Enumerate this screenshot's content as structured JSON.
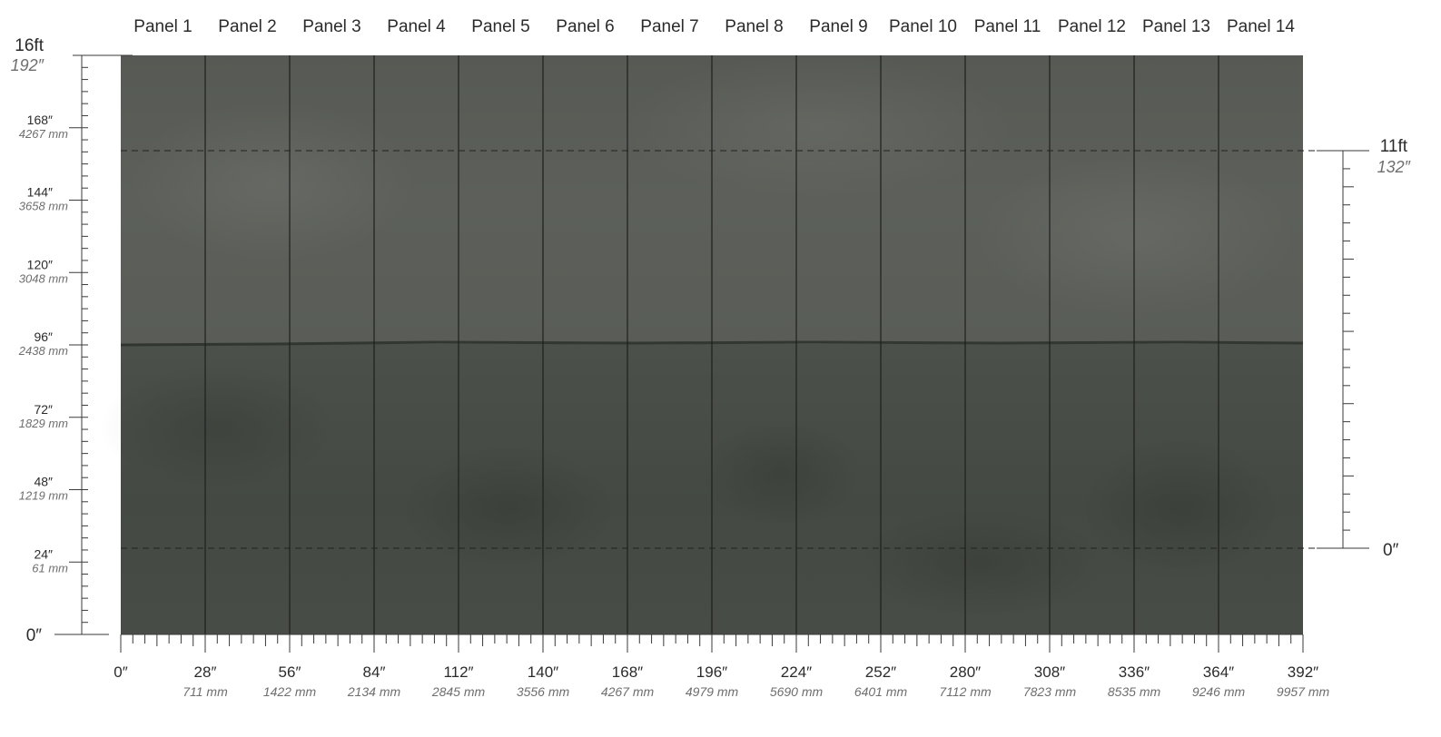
{
  "panels": [
    "Panel 1",
    "Panel 2",
    "Panel 3",
    "Panel 4",
    "Panel 5",
    "Panel 6",
    "Panel 7",
    "Panel 8",
    "Panel 9",
    "Panel 10",
    "Panel 11",
    "Panel 12",
    "Panel 13",
    "Panel 14"
  ],
  "colors": {
    "upper_wall": "#5a5c56",
    "lower_wall": "#474b45",
    "paint_line": "#2f322d",
    "panel_seam": "#1f1f1f",
    "dashed_line": "#222222",
    "ruler": "#3a3a3a"
  },
  "bottom_ruler": {
    "max_inches": 392,
    "labels": [
      {
        "in": "0″",
        "mm": ""
      },
      {
        "in": "28″",
        "mm": "711 mm"
      },
      {
        "in": "56″",
        "mm": "1422 mm"
      },
      {
        "in": "84″",
        "mm": "2134 mm"
      },
      {
        "in": "112″",
        "mm": "2845 mm"
      },
      {
        "in": "140″",
        "mm": "3556 mm"
      },
      {
        "in": "168″",
        "mm": "4267 mm"
      },
      {
        "in": "196″",
        "mm": "4979 mm"
      },
      {
        "in": "224″",
        "mm": "5690 mm"
      },
      {
        "in": "252″",
        "mm": "6401 mm"
      },
      {
        "in": "280″",
        "mm": "7112 mm"
      },
      {
        "in": "308″",
        "mm": "7823 mm"
      },
      {
        "in": "336″",
        "mm": "8535 mm"
      },
      {
        "in": "364″",
        "mm": "9246 mm"
      },
      {
        "in": "392″",
        "mm": "9957 mm"
      }
    ]
  },
  "left_ruler": {
    "top_ft": "16ft",
    "top_in": "192″",
    "bottom": "0″",
    "labels": [
      {
        "in": "168″",
        "mm": "4267 mm"
      },
      {
        "in": "144″",
        "mm": "3658 mm"
      },
      {
        "in": "120″",
        "mm": "3048 mm"
      },
      {
        "in": "96″",
        "mm": "2438 mm"
      },
      {
        "in": "72″",
        "mm": "1829 mm"
      },
      {
        "in": "48″",
        "mm": "1219 mm"
      },
      {
        "in": "24″",
        "mm": "61 mm"
      }
    ]
  },
  "right_ruler": {
    "top_ft": "11ft",
    "top_in": "132″",
    "bottom": "0″"
  }
}
